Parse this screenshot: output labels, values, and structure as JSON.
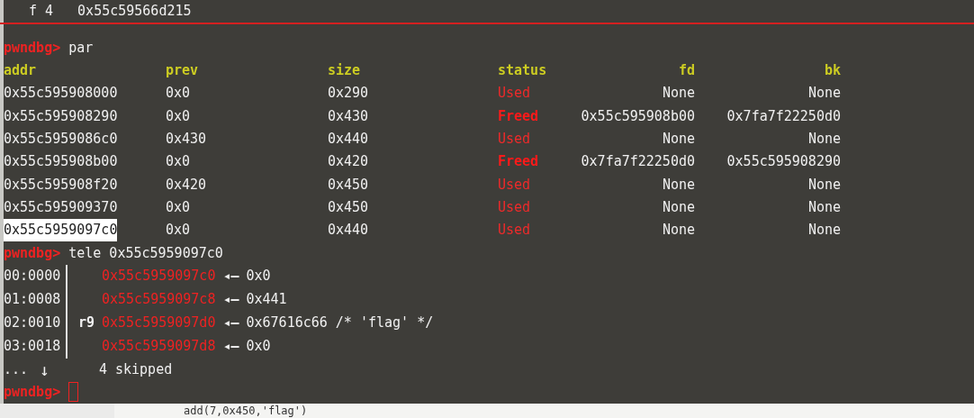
{
  "previous_line": {
    "frame": "f 4",
    "address": "0x55c59566d215"
  },
  "par": {
    "prompt": "pwndbg>",
    "command": "par",
    "columns": [
      "addr",
      "prev",
      "size",
      "status",
      "fd",
      "bk"
    ],
    "rows": [
      {
        "addr": "0x55c595908000",
        "prev": "0x0",
        "size": "0x290",
        "status": "Used",
        "freed": false,
        "fd": "None",
        "bk": "None",
        "selected": false
      },
      {
        "addr": "0x55c595908290",
        "prev": "0x0",
        "size": "0x430",
        "status": "Freed",
        "freed": true,
        "fd": "0x55c595908b00",
        "bk": "0x7fa7f22250d0",
        "selected": false
      },
      {
        "addr": "0x55c5959086c0",
        "prev": "0x430",
        "size": "0x440",
        "status": "Used",
        "freed": false,
        "fd": "None",
        "bk": "None",
        "selected": false
      },
      {
        "addr": "0x55c595908b00",
        "prev": "0x0",
        "size": "0x420",
        "status": "Freed",
        "freed": true,
        "fd": "0x7fa7f22250d0",
        "bk": "0x55c595908290",
        "selected": false
      },
      {
        "addr": "0x55c595908f20",
        "prev": "0x420",
        "size": "0x450",
        "status": "Used",
        "freed": false,
        "fd": "None",
        "bk": "None",
        "selected": false
      },
      {
        "addr": "0x55c595909370",
        "prev": "0x0",
        "size": "0x450",
        "status": "Used",
        "freed": false,
        "fd": "None",
        "bk": "None",
        "selected": false
      },
      {
        "addr": "0x55c5959097c0",
        "prev": "0x0",
        "size": "0x440",
        "status": "Used",
        "freed": false,
        "fd": "None",
        "bk": "None",
        "selected": true
      }
    ]
  },
  "tele": {
    "prompt": "pwndbg>",
    "command": "tele 0x55c5959097c0",
    "rows": [
      {
        "index": "00:0000",
        "register": "",
        "address": "0x55c5959097c0",
        "arrow": "◂—",
        "value": "0x0"
      },
      {
        "index": "01:0008",
        "register": "",
        "address": "0x55c5959097c8",
        "arrow": "◂—",
        "value": "0x441"
      },
      {
        "index": "02:0010",
        "register": "r9",
        "address": "0x55c5959097d0",
        "arrow": "◂—",
        "value": "0x67616c66 /* 'flag' */"
      },
      {
        "index": "03:0018",
        "register": "",
        "address": "0x55c5959097d8",
        "arrow": "◂—",
        "value": "0x0"
      }
    ],
    "skipped": {
      "dots": "...",
      "arrow": "↓",
      "text": "4 skipped"
    }
  },
  "final_prompt": "pwndbg>",
  "background_editor_line": "add(7,0x450,'flag')"
}
